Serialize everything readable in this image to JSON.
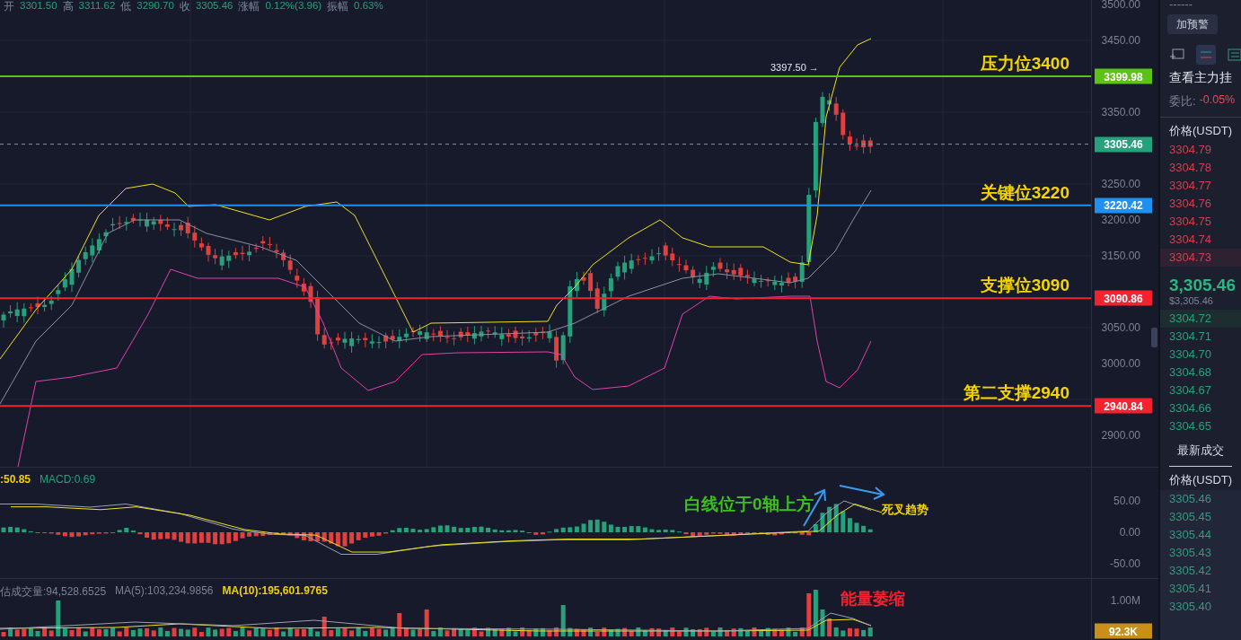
{
  "ohlc_bar": [
    {
      "label": "开",
      "value": "3301.50"
    },
    {
      "label": "高",
      "value": "3311.62"
    },
    {
      "label": "低",
      "value": "3290.70"
    },
    {
      "label": "收",
      "value": "3305.46"
    },
    {
      "label": "涨幅",
      "value": "0.12%(3.96)"
    },
    {
      "label": "振幅",
      "value": "0.63%"
    }
  ],
  "price_pane": {
    "axis_ticks": [
      "3500.00",
      "3450.00",
      "3350.00",
      "3250.00",
      "3200.00",
      "3150.00",
      "3050.00",
      "3000.00",
      "2900.00"
    ],
    "levels": [
      {
        "label": "压力位3400",
        "tag": "3399.98",
        "color": "#5cc215"
      },
      {
        "label": "关键位3220",
        "tag": "3220.42",
        "color": "#1f8ff0"
      },
      {
        "label": "支撑位3090",
        "tag": "3090.86",
        "color": "#f2222f"
      },
      {
        "label": "第二支撑2940",
        "tag": "2940.84",
        "color": "#f2222f"
      }
    ],
    "current_price": {
      "tag": "3305.46",
      "color": "#26a17b"
    },
    "high_marker": "3397.50 →"
  },
  "macd_pane": {
    "legend": [
      {
        "text": ":50.85",
        "color": "#f0d000"
      },
      {
        "text": "MACD:0.69",
        "color": "#26a17b"
      }
    ],
    "axis_ticks": [
      "50.00",
      "0.00",
      "-50.00"
    ],
    "annotations": [
      {
        "text": "白线位于0轴上方",
        "color": "#3cc01c"
      },
      {
        "text": "死叉趋势",
        "color": "#f5d400"
      }
    ]
  },
  "volume_pane": {
    "legend": [
      {
        "text": "估成交量:94,528.6525",
        "color": "#7a8296"
      },
      {
        "text": "MA(5):103,234.9856",
        "color": "#7a8296"
      },
      {
        "text": "MA(10):195,601.9765",
        "color": "#f0d000"
      }
    ],
    "axis_ticks": [
      "1.00M"
    ],
    "current_tag": "92.3K",
    "annotation": {
      "text": "能量萎缩",
      "color": "#f2222f"
    }
  },
  "order_book": {
    "header_dashes": "------",
    "alert_button": "加预警",
    "view_modes": [
      {
        "selected": false
      },
      {
        "selected": true
      },
      {
        "selected": false
      }
    ],
    "view_orders": "查看主力挂",
    "ratio_label": "委比:",
    "ratio_value": "-0.05%",
    "price_header": "价格(USDT)",
    "asks": [
      {
        "price": "3304.79",
        "highlighted": false
      },
      {
        "price": "3304.78",
        "highlighted": false
      },
      {
        "price": "3304.77",
        "highlighted": false
      },
      {
        "price": "3304.76",
        "highlighted": false
      },
      {
        "price": "3304.75",
        "highlighted": false
      },
      {
        "price": "3304.74",
        "highlighted": false
      },
      {
        "price": "3304.73",
        "highlighted": true
      }
    ],
    "last_price": "3,305.46",
    "last_price_usd": "$3,305.46",
    "bids": [
      {
        "price": "3304.72",
        "highlighted": true
      },
      {
        "price": "3304.71",
        "highlighted": false
      },
      {
        "price": "3304.70",
        "highlighted": false
      },
      {
        "price": "3304.68",
        "highlighted": false
      },
      {
        "price": "3304.67",
        "highlighted": false
      },
      {
        "price": "3304.66",
        "highlighted": false
      },
      {
        "price": "3304.65",
        "highlighted": false
      }
    ]
  },
  "trades": {
    "tab": "最新成交",
    "price_header": "价格(USDT)",
    "prices": [
      "3305.46",
      "3305.45",
      "3305.44",
      "3305.43",
      "3305.42",
      "3305.41",
      "3305.40"
    ]
  }
}
